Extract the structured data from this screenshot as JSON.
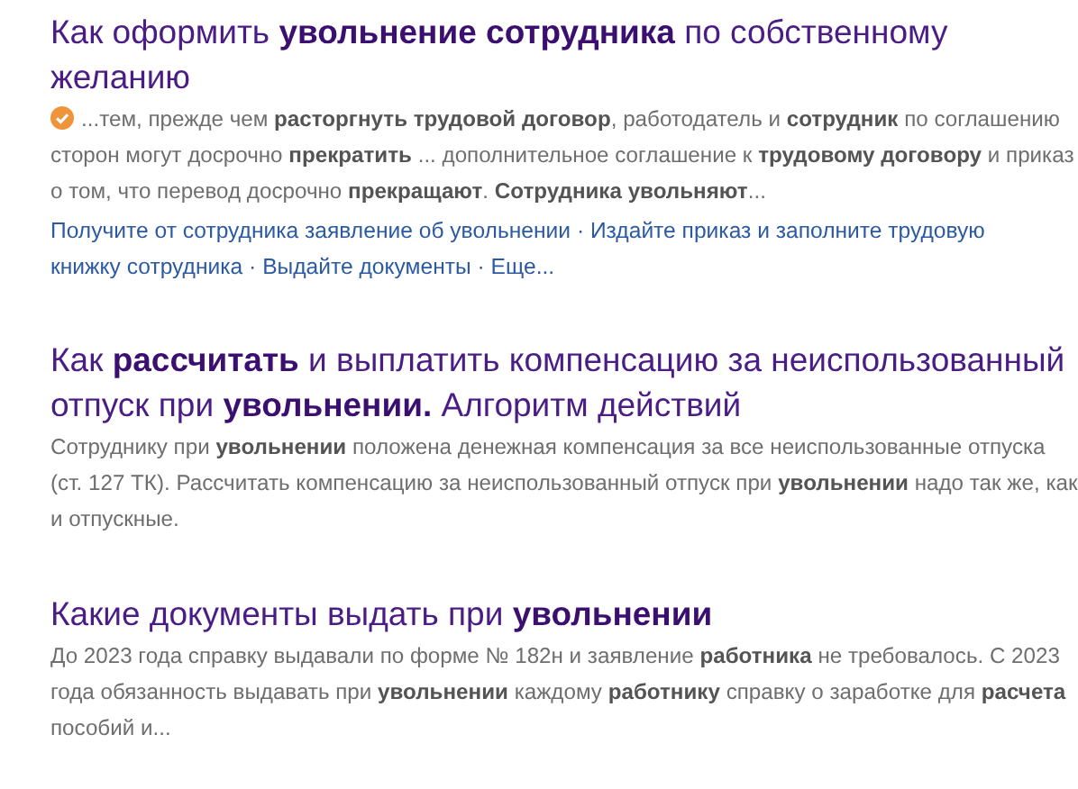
{
  "results": [
    {
      "title": "Как оформить **увольнение сотрудника** по собственному желанию",
      "verified": true,
      "snippet": "...тем, прежде чем **расторгнуть трудовой договор**, работодатель и **сотрудник** по соглашению сторон могут досрочно **прекратить** ... дополнительное соглашение к **трудовому договору** и приказ о том, что перевод досрочно **прекращают**. **Сотрудника увольняют**...",
      "separator": "·",
      "sitelinks": [
        [
          "Получите от сотрудника заявление об увольнении"
        ],
        [
          "Издайте приказ и заполните трудовую",
          "книжку сотрудника"
        ],
        [
          "Выдайте документы"
        ],
        [
          "Еще..."
        ]
      ]
    },
    {
      "title": "Как **рассчитать** и выплатить компенсацию за неиспользованный отпуск при **увольнении.** Алгоритм действий",
      "verified": false,
      "snippet": "Сотруднику при **увольнении** положена денежная компенсация за все неиспользованные отпуска (ст. 127 ТК). Рассчитать компенсацию за неиспользованный отпуск при **увольнении** надо так же, как и отпускные."
    },
    {
      "title": "Какие документы выдать при **увольнении**",
      "verified": false,
      "snippet": "До 2023 года справку выдавали по форме № 182н и заявление **работника** не требовалось. С 2023 года обязанность выдавать при **увольнении** каждому **работнику** справку о заработке для **расчета** пособий и..."
    }
  ]
}
